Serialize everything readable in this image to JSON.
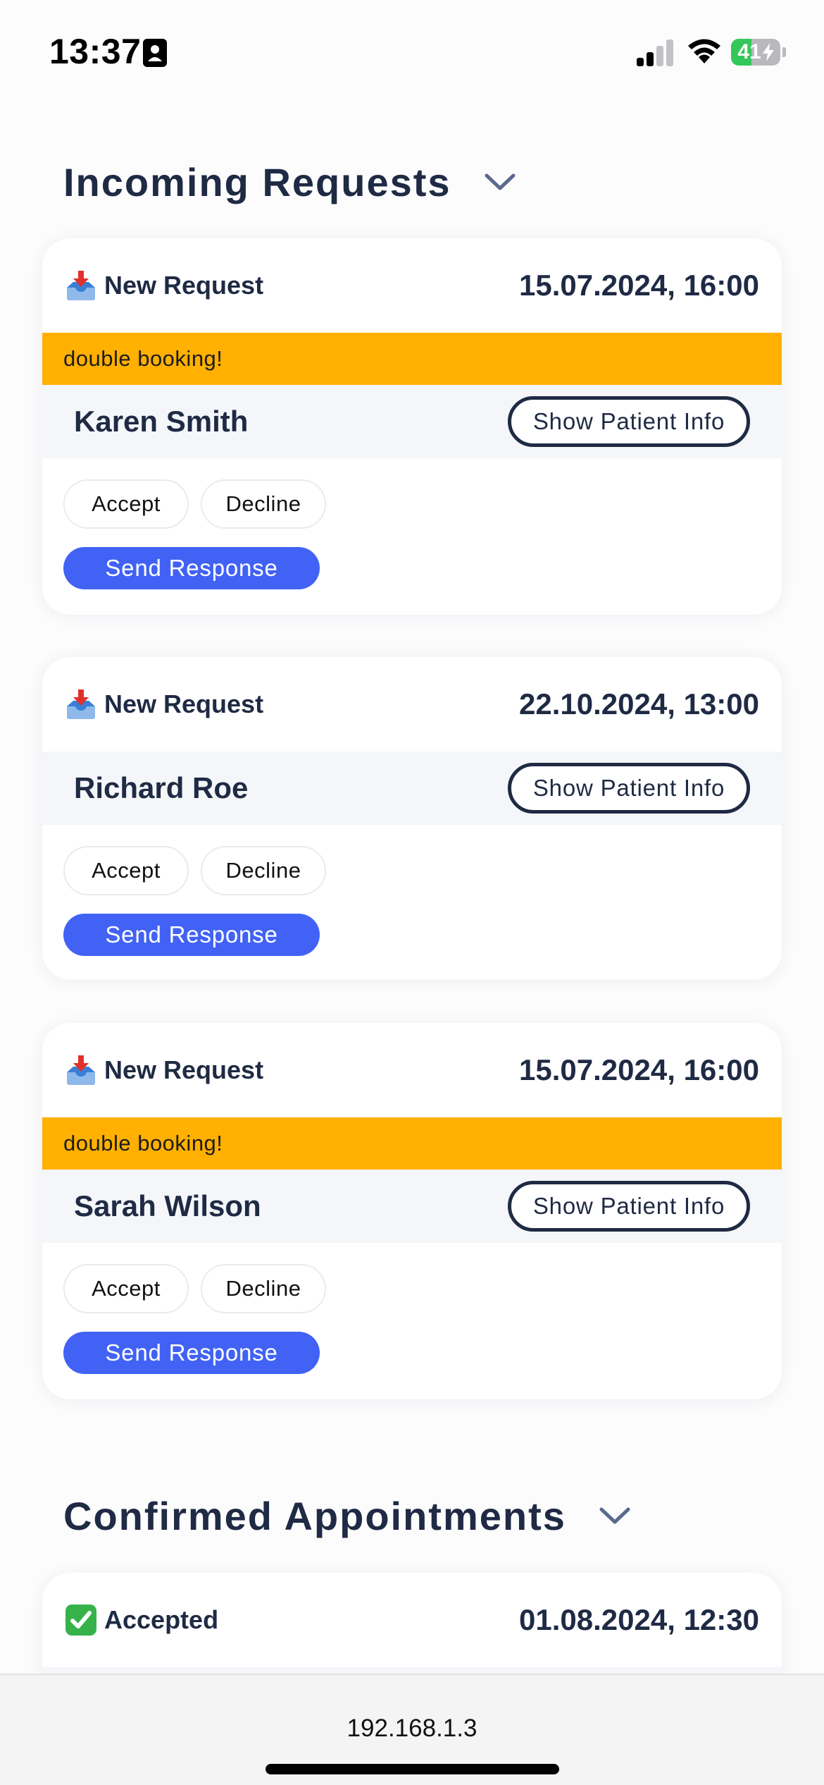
{
  "status_bar": {
    "time": "13:37",
    "battery_level": "41",
    "battery_percent": 41,
    "battery_color": "#34c759",
    "icons": [
      "contact-card-icon",
      "cellular-signal-icon",
      "wifi-icon",
      "battery-charging-icon"
    ]
  },
  "sections": {
    "incoming": {
      "title": "Incoming Requests",
      "icon": "chevron-down-icon"
    },
    "confirmed": {
      "title": "Confirmed Appointments",
      "icon": "chevron-down-icon"
    }
  },
  "requests": [
    {
      "status": "New Request",
      "status_icon": "inbox-tray-icon",
      "datetime": "15.07.2024, 16:00",
      "warning": "double booking!",
      "patient": "Karen Smith",
      "info_button": "Show Patient Info",
      "accept_label": "Accept",
      "decline_label": "Decline",
      "send_label": "Send Response"
    },
    {
      "status": "New Request",
      "status_icon": "inbox-tray-icon",
      "datetime": "22.10.2024, 13:00",
      "patient": "Richard Roe",
      "info_button": "Show Patient Info",
      "accept_label": "Accept",
      "decline_label": "Decline",
      "send_label": "Send Response"
    },
    {
      "status": "New Request",
      "status_icon": "inbox-tray-icon",
      "datetime": "15.07.2024, 16:00",
      "warning": "double booking!",
      "patient": "Sarah Wilson",
      "info_button": "Show Patient Info",
      "accept_label": "Accept",
      "decline_label": "Decline",
      "send_label": "Send Response"
    }
  ],
  "confirmed": [
    {
      "status": "Accepted",
      "status_icon": "check-mark-icon",
      "datetime": "01.08.2024, 12:30"
    }
  ],
  "browser": {
    "url": "192.168.1.3"
  },
  "colors": {
    "primary": "#4162f5",
    "warning": "#ffb000",
    "heading": "#1f2a44",
    "accepted": "#34c759"
  }
}
